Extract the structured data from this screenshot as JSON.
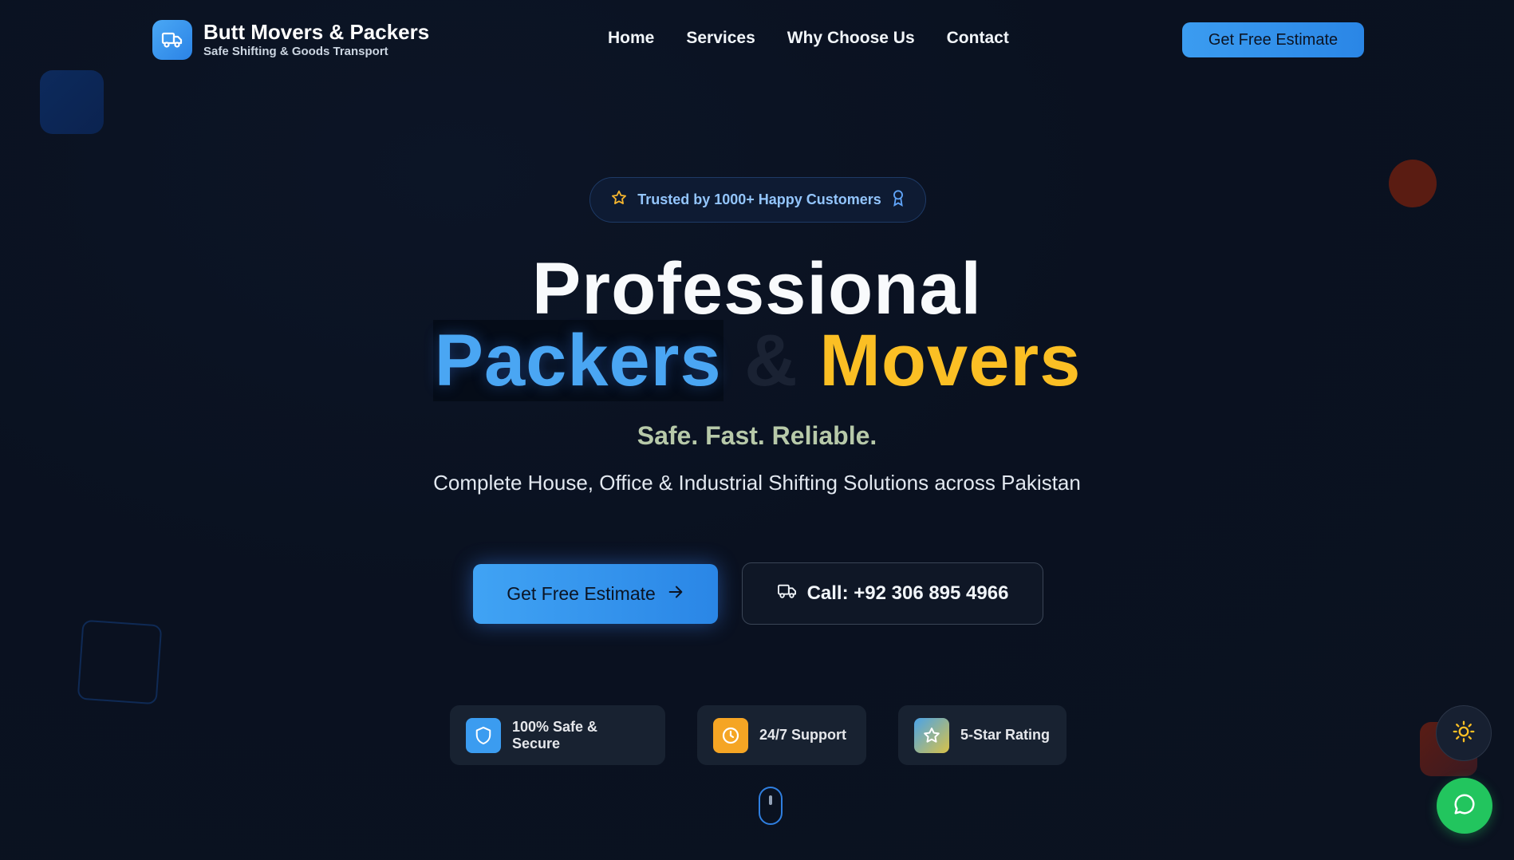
{
  "brand": {
    "name": "Butt Movers & Packers",
    "tagline": "Safe Shifting & Goods Transport",
    "logo_icon": "truck-icon"
  },
  "nav": {
    "links": [
      "Home",
      "Services",
      "Why Choose Us",
      "Contact"
    ],
    "cta_label": "Get Free Estimate"
  },
  "hero": {
    "badge_text": "Trusted by 1000+ Happy Customers",
    "badge_icons": [
      "star-icon",
      "award-icon"
    ],
    "title_line1": "Professional",
    "title_word_packers": "Packers",
    "title_amp": "&",
    "title_word_movers": "Movers",
    "tagline": "Safe. Fast. Reliable.",
    "subtitle": "Complete House, Office & Industrial Shifting Solutions across Pakistan",
    "primary_cta": "Get Free Estimate",
    "call_cta": "Call: +92 306 895 4966"
  },
  "features": [
    {
      "label": "100% Safe & Secure",
      "icon": "shield-icon",
      "color": "#3b9cf0"
    },
    {
      "label": "24/7 Support",
      "icon": "clock-icon",
      "color": "#f5a524"
    },
    {
      "label": "5-Star Rating",
      "icon": "star-icon",
      "color": "#5ba7d8"
    }
  ],
  "colors": {
    "accent_blue": "#3b9cf0",
    "accent_yellow": "#fbbf24",
    "whatsapp_green": "#22c55e",
    "background": "#0b1220"
  },
  "floating": {
    "theme_icon": "sun-icon",
    "chat_icon": "chat-bubble-icon"
  }
}
